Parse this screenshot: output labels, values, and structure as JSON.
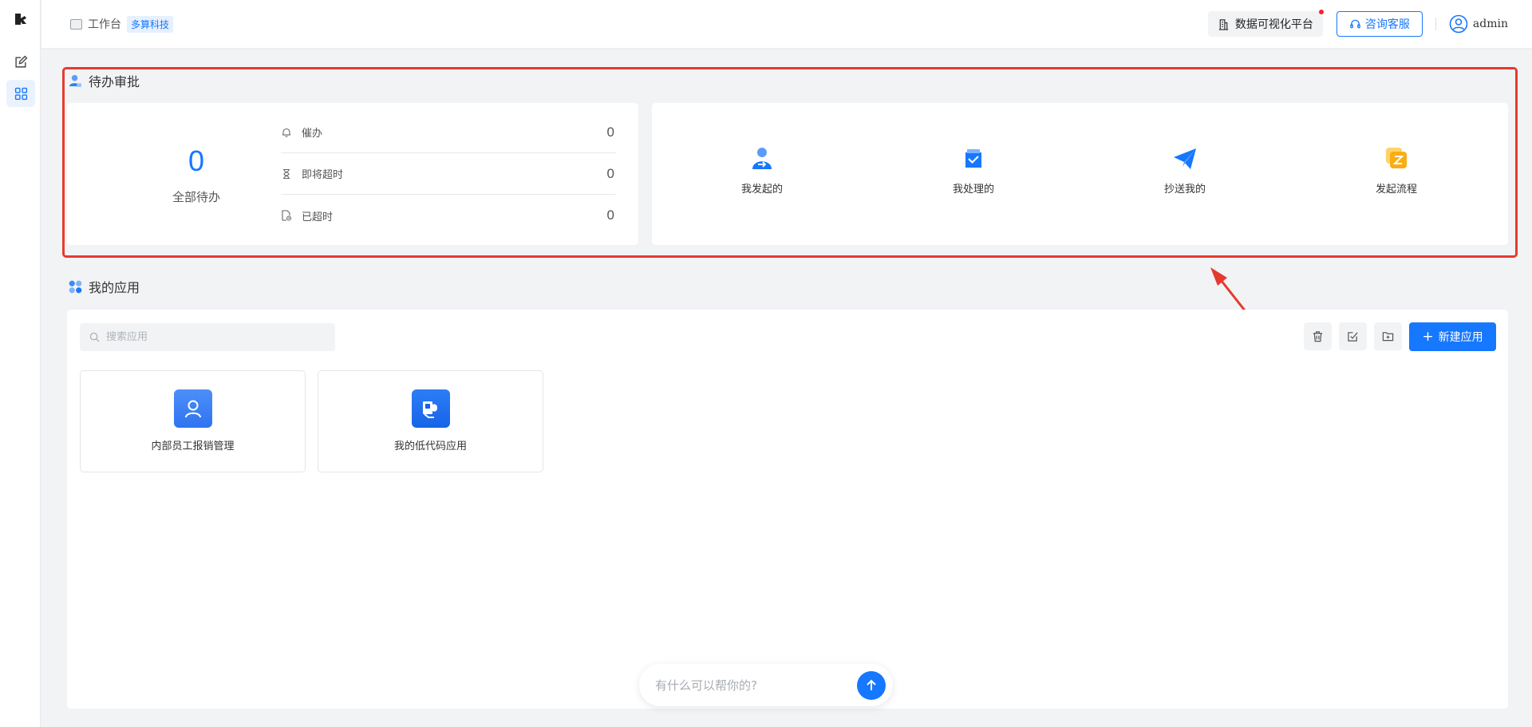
{
  "header": {
    "breadcrumb": "工作台",
    "org_tag": "多算科技",
    "dataviz_label": "数据可视化平台",
    "consult_label": "咨询客服",
    "username": "admin"
  },
  "todo": {
    "title": "待办审批",
    "total_count": "0",
    "total_label": "全部待办",
    "rows": [
      {
        "label": "催办",
        "value": "0",
        "icon": "bell-icon"
      },
      {
        "label": "即将超时",
        "value": "0",
        "icon": "hourglass-icon"
      },
      {
        "label": "已超时",
        "value": "0",
        "icon": "overdue-file-icon"
      }
    ],
    "quick": [
      {
        "label": "我发起的",
        "icon": "initiated-by-me-icon"
      },
      {
        "label": "我处理的",
        "icon": "handled-by-me-icon"
      },
      {
        "label": "抄送我的",
        "icon": "cc-me-icon"
      },
      {
        "label": "发起流程",
        "icon": "start-process-icon"
      }
    ]
  },
  "apps": {
    "title": "我的应用",
    "search_placeholder": "搜索应用",
    "new_button": "新建应用",
    "items": [
      {
        "name": "内部员工报销管理",
        "icon": "user-icon"
      },
      {
        "name": "我的低代码应用",
        "icon": "camera-app-icon"
      }
    ]
  },
  "chat": {
    "placeholder": "有什么可以帮你的?"
  },
  "colors": {
    "primary": "#1677ff",
    "highlight": "#e53a2f",
    "background": "#f2f3f5"
  }
}
